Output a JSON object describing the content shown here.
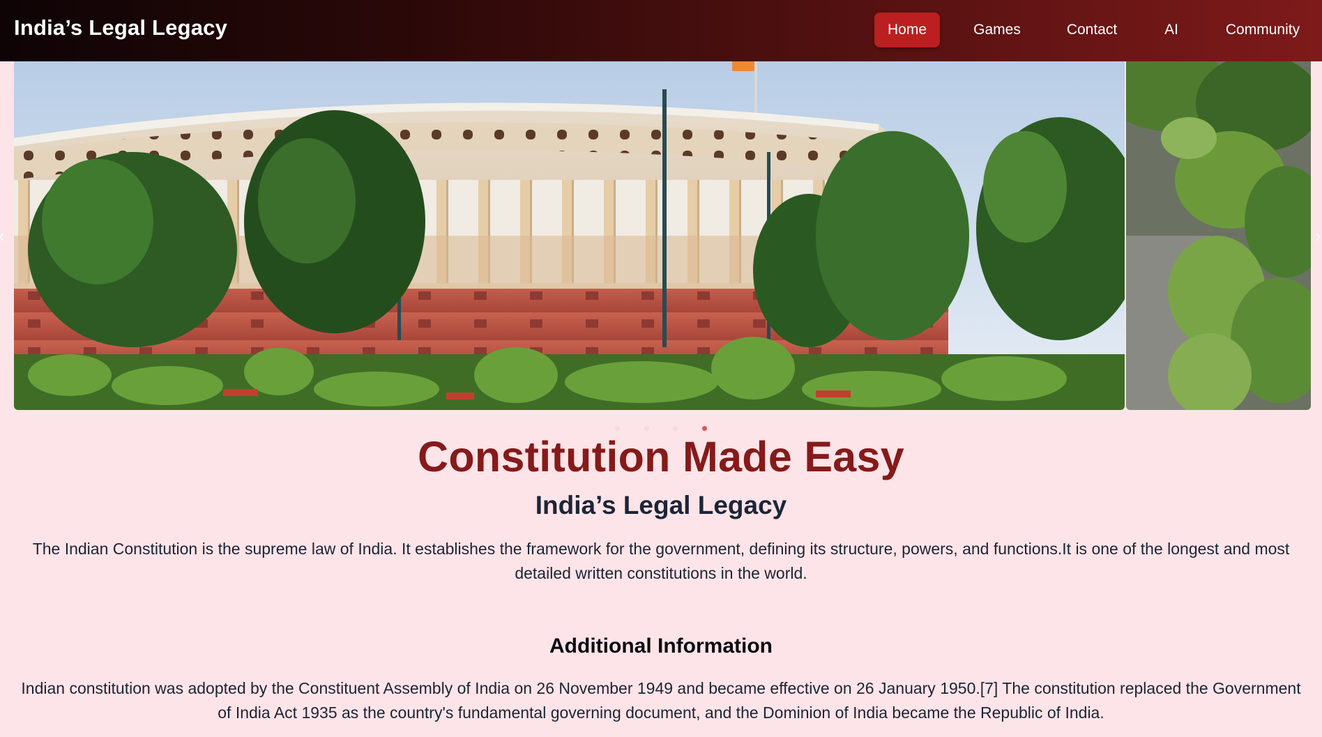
{
  "navbar": {
    "brand": "India’s Legal Legacy",
    "items": [
      {
        "label": "Home",
        "active": true
      },
      {
        "label": "Games",
        "active": false
      },
      {
        "label": "Contact",
        "active": false
      },
      {
        "label": "AI",
        "active": false
      },
      {
        "label": "Community",
        "active": false
      }
    ],
    "accent_color": "#bc1f1f"
  },
  "carousel": {
    "slides": [
      {
        "image": "parliament-house-photo"
      },
      {
        "image": "trees-aerial-photo"
      }
    ],
    "active_dot": 3,
    "dot_count": 4,
    "prev_icon": "chevron-left-icon",
    "next_icon": "chevron-right-icon"
  },
  "hero": {
    "title": "Constitution Made Easy",
    "subtitle": "India’s Legal Legacy",
    "intro": "The Indian Constitution is the supreme law of India. It establishes the framework for the government, defining its structure, powers, and functions.It is one of the longest and most detailed written constitutions in the world."
  },
  "additional": {
    "heading": "Additional Information",
    "text": "Indian constitution was adopted by the Constituent Assembly of India on 26 November 1949 and became effective on 26 January 1950.[7] The constitution replaced the Government of India Act 1935 as the country's fundamental governing document, and the Dominion of India became the Republic of India."
  },
  "colors": {
    "page_background": "#fde4e8",
    "title_color": "#851a1a",
    "text_color": "#1c2533"
  }
}
